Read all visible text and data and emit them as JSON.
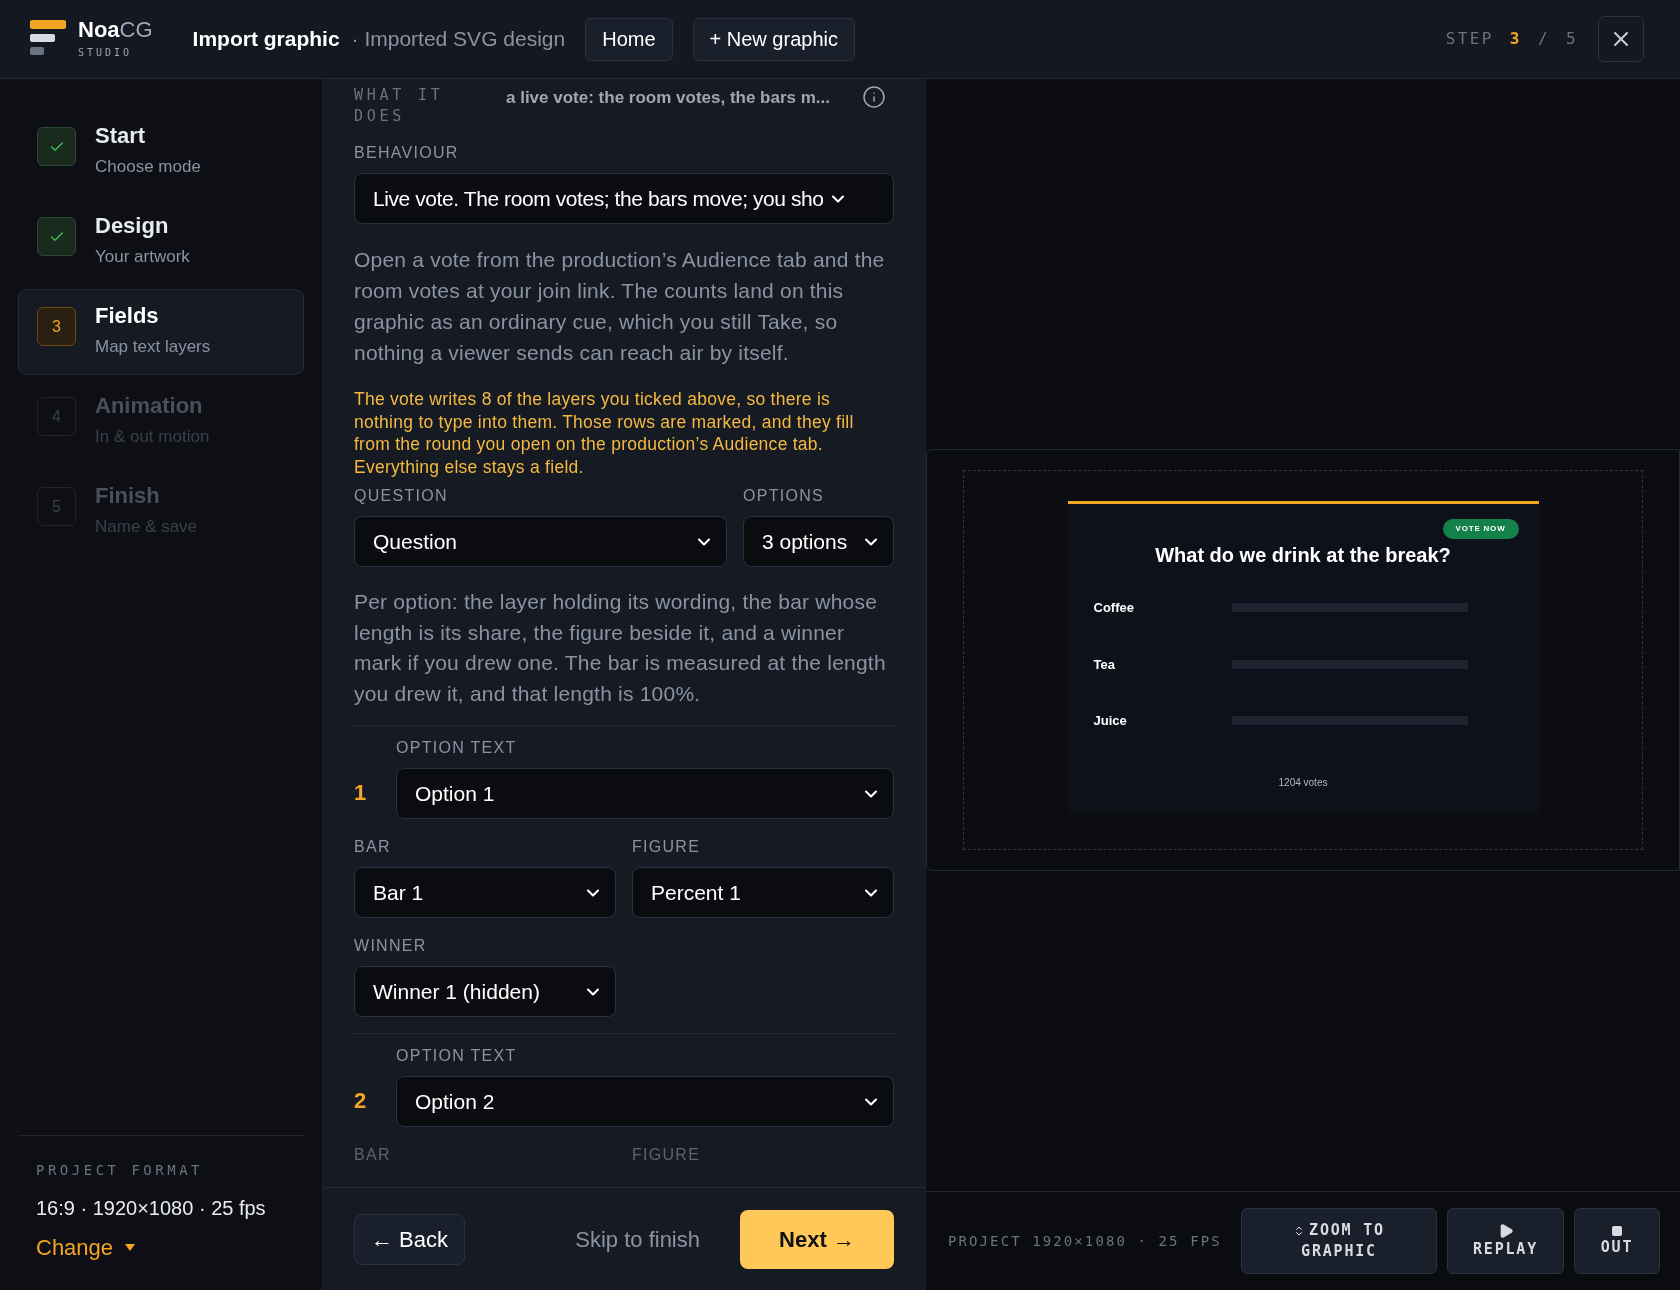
{
  "header": {
    "brand": {
      "name_bold": "Noa",
      "name_light": "CG",
      "sub": "STUDIO"
    },
    "title": "Import graphic",
    "subtitle": "· Imported SVG design",
    "buttons": [
      "Home",
      "+ New graphic"
    ],
    "step": {
      "label": "STEP",
      "current": "3",
      "separator": "/",
      "total": "5"
    }
  },
  "steps": [
    {
      "title": "Start",
      "subtitle": "Choose mode",
      "kind": "done",
      "selected": false
    },
    {
      "title": "Design",
      "subtitle": "Your artwork",
      "kind": "done",
      "selected": false
    },
    {
      "number": "3",
      "title": "Fields",
      "subtitle": "Map text layers",
      "kind": "current",
      "selected": true
    },
    {
      "number": "4",
      "title": "Animation",
      "subtitle": "In & out motion",
      "kind": "todo",
      "selected": false
    },
    {
      "number": "5",
      "title": "Finish",
      "subtitle": "Name & save",
      "kind": "todo",
      "selected": false
    }
  ],
  "project_format": {
    "label": "PROJECT FORMAT",
    "value": "16:9 · 1920×1080 · 25 fps",
    "action": "Change"
  },
  "form": {
    "what_it_does": {
      "label": "WHAT IT DOES",
      "value": "a live vote: the room votes, the bars m..."
    },
    "behaviour": {
      "label": "BEHAVIOUR",
      "value": "Live vote. The room votes; the bars move; you sho"
    },
    "description": "Open a vote from the production’s Audience tab and the room votes at your join link. The counts land on this graphic as an ordinary cue, which you still Take, so nothing a viewer sends can reach air by itself.",
    "notice": "The vote writes 8 of the layers you ticked above, so there is nothing to type into them. Those rows are marked, and they fill from the round you open on the production’s Audience tab. Everything else stays a field.",
    "question": {
      "label": "QUESTION",
      "value": "Question"
    },
    "options_count": {
      "label": "OPTIONS",
      "value": "3 options"
    },
    "per_option": "Per option: the layer holding its wording, the bar whose length is its share, the figure beside it, and a winner mark if you drew one. The bar is measured at the length you drew it, and that length is 100%.",
    "options": [
      {
        "number": "1",
        "text_label": "OPTION TEXT",
        "text": "Option 1",
        "bar_label": "BAR",
        "bar": "Bar 1",
        "figure_label": "FIGURE",
        "figure": "Percent 1",
        "winner_label": "WINNER",
        "winner": "Winner 1 (hidden)"
      },
      {
        "number": "2",
        "text_label": "OPTION TEXT",
        "text": "Option 2",
        "bar_label": "BAR",
        "figure_label": "FIGURE"
      }
    ]
  },
  "footer": {
    "back": "← Back",
    "skip": "Skip to finish",
    "next": "Next →"
  },
  "preview": {
    "badge": "VOTE NOW",
    "title": "What do we drink at the break?",
    "rows": [
      {
        "label": "Coffee"
      },
      {
        "label": "Tea"
      },
      {
        "label": "Juice"
      }
    ],
    "votes": "1204 votes"
  },
  "preview_bar": {
    "info": "PROJECT 1920×1080 · 25 FPS",
    "buttons": [
      {
        "kind": "zoom",
        "label": "ZOOM TO GRAPHIC"
      },
      {
        "kind": "replay",
        "label": "REPLAY"
      },
      {
        "kind": "out",
        "label": "OUT"
      }
    ]
  }
}
